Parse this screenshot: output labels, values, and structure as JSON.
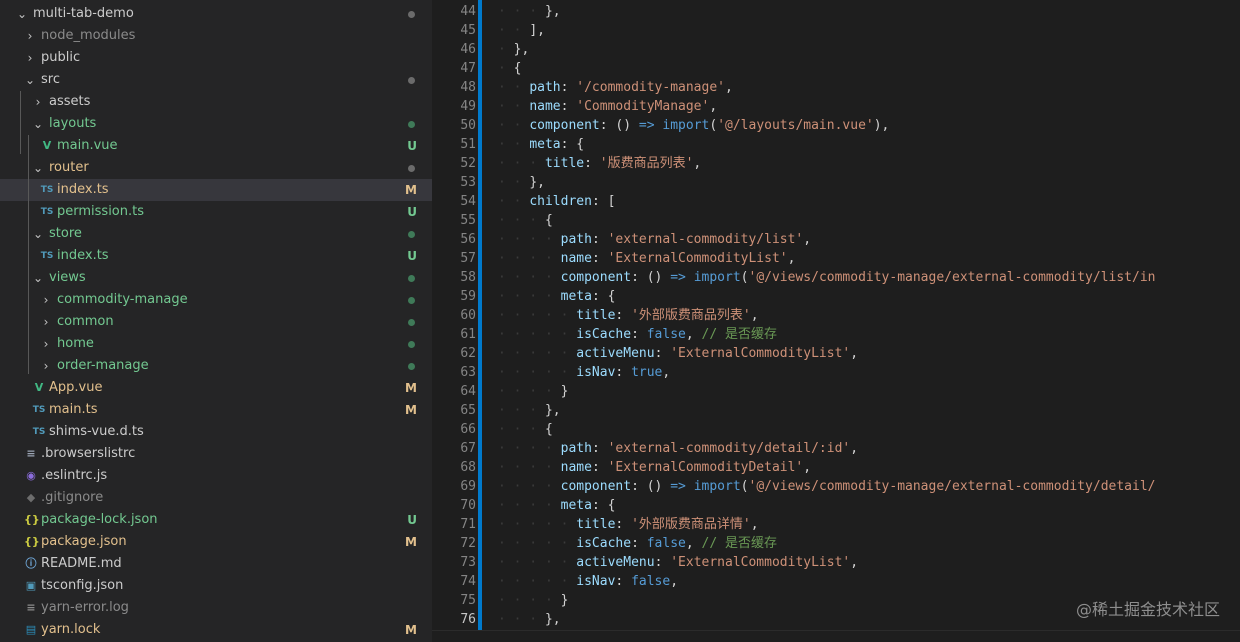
{
  "colors": {
    "folder_text": "#cccccc",
    "green_file": "#73c991",
    "modified_file": "#e2c08d",
    "untracked_badge": "#73c991",
    "modified_badge": "#e2c08d",
    "ts_icon": "#519aba",
    "vue_icon": "#41b883",
    "json_icon": "#cbcb41",
    "accent": "#007acc"
  },
  "explorer": {
    "rows": [
      {
        "label": "multi-tab-demo",
        "chevron": "⌄",
        "status": "dot-gray"
      },
      {
        "label": "node_modules",
        "chevron": "›",
        "dim": true
      },
      {
        "label": "public",
        "chevron": "›"
      },
      {
        "label": "src",
        "chevron": "⌄",
        "status": "dot-gray"
      },
      {
        "label": "assets",
        "chevron": "›"
      },
      {
        "label": "layouts",
        "chevron": "⌄",
        "status": "dot-green",
        "color": "green"
      },
      {
        "label": "main.vue",
        "icon": "vue-icon",
        "icon_glyph": "V",
        "badge": "U",
        "color": "green"
      },
      {
        "label": "router",
        "chevron": "⌄",
        "status": "dot-gray",
        "color": "yellow"
      },
      {
        "label": "index.ts",
        "icon": "ts-icon",
        "icon_glyph": "TS",
        "badge": "M",
        "color": "yellow",
        "selected": true
      },
      {
        "label": "permission.ts",
        "icon": "ts-icon",
        "icon_glyph": "TS",
        "badge": "U",
        "color": "green"
      },
      {
        "label": "store",
        "chevron": "⌄",
        "status": "dot-green",
        "color": "green"
      },
      {
        "label": "index.ts",
        "icon": "ts-icon",
        "icon_glyph": "TS",
        "badge": "U",
        "color": "green"
      },
      {
        "label": "views",
        "chevron": "⌄",
        "status": "dot-green",
        "color": "green"
      },
      {
        "label": "commodity-manage",
        "chevron": "›",
        "status": "dot-green",
        "color": "green"
      },
      {
        "label": "common",
        "chevron": "›",
        "status": "dot-green",
        "color": "green"
      },
      {
        "label": "home",
        "chevron": "›",
        "status": "dot-green",
        "color": "green"
      },
      {
        "label": "order-manage",
        "chevron": "›",
        "status": "dot-green",
        "color": "green"
      },
      {
        "label": "App.vue",
        "icon": "vue-icon",
        "icon_glyph": "V",
        "badge": "M",
        "color": "yellow"
      },
      {
        "label": "main.ts",
        "icon": "ts-icon",
        "icon_glyph": "TS",
        "badge": "M",
        "color": "yellow"
      },
      {
        "label": "shims-vue.d.ts",
        "icon": "ts-icon",
        "icon_glyph": "TS"
      },
      {
        "label": ".browserslistrc",
        "icon": "lines-icon",
        "icon_glyph": "≡"
      },
      {
        "label": ".eslintrc.js",
        "icon": "eslint-icon",
        "icon_glyph": "◉"
      },
      {
        "label": ".gitignore",
        "icon": "git-icon",
        "icon_glyph": "◆",
        "dim": true
      },
      {
        "label": "package-lock.json",
        "icon": "json-icon",
        "icon_glyph": "{}",
        "badge": "U",
        "color": "green"
      },
      {
        "label": "package.json",
        "icon": "json-icon",
        "icon_glyph": "{}",
        "badge": "M",
        "color": "yellow"
      },
      {
        "label": "README.md",
        "icon": "info-icon",
        "icon_glyph": "ⓘ"
      },
      {
        "label": "tsconfig.json",
        "icon": "tsconfig-icon",
        "icon_glyph": "▣"
      },
      {
        "label": "yarn-error.log",
        "icon": "log-icon",
        "icon_glyph": "≡",
        "dim": true
      },
      {
        "label": "yarn.lock",
        "icon": "yarn-icon",
        "icon_glyph": "▤",
        "badge": "M",
        "color": "yellow"
      }
    ]
  },
  "editor": {
    "active_line": "76",
    "lines": [
      {
        "n": "44",
        "indent": 3,
        "tokens": [
          [
            "p",
            "},"
          ]
        ]
      },
      {
        "n": "45",
        "indent": 2,
        "tokens": [
          [
            "p",
            "],"
          ]
        ]
      },
      {
        "n": "46",
        "indent": 1,
        "tokens": [
          [
            "p",
            "},"
          ]
        ]
      },
      {
        "n": "47",
        "indent": 1,
        "tokens": [
          [
            "p",
            "{"
          ]
        ]
      },
      {
        "n": "48",
        "indent": 2,
        "tokens": [
          [
            "k",
            "path"
          ],
          [
            "p",
            ": "
          ],
          [
            "s",
            "'/commodity-manage'"
          ],
          [
            "p",
            ","
          ]
        ]
      },
      {
        "n": "49",
        "indent": 2,
        "tokens": [
          [
            "k",
            "name"
          ],
          [
            "p",
            ": "
          ],
          [
            "s",
            "'CommodityManage'"
          ],
          [
            "p",
            ","
          ]
        ]
      },
      {
        "n": "50",
        "indent": 2,
        "tokens": [
          [
            "k",
            "component"
          ],
          [
            "p",
            ": () "
          ],
          [
            "kw",
            "=>"
          ],
          [
            "p",
            " "
          ],
          [
            "kw",
            "import"
          ],
          [
            "p",
            "("
          ],
          [
            "s",
            "'@/layouts/main.vue'"
          ],
          [
            "p",
            "),"
          ]
        ]
      },
      {
        "n": "51",
        "indent": 2,
        "tokens": [
          [
            "k",
            "meta"
          ],
          [
            "p",
            ": {"
          ]
        ]
      },
      {
        "n": "52",
        "indent": 3,
        "tokens": [
          [
            "k",
            "title"
          ],
          [
            "p",
            ": "
          ],
          [
            "s",
            "'版费商品列表'"
          ],
          [
            "p",
            ","
          ]
        ]
      },
      {
        "n": "53",
        "indent": 2,
        "tokens": [
          [
            "p",
            "},"
          ]
        ]
      },
      {
        "n": "54",
        "indent": 2,
        "tokens": [
          [
            "k",
            "children"
          ],
          [
            "p",
            ": ["
          ]
        ]
      },
      {
        "n": "55",
        "indent": 3,
        "tokens": [
          [
            "p",
            "{"
          ]
        ]
      },
      {
        "n": "56",
        "indent": 4,
        "tokens": [
          [
            "k",
            "path"
          ],
          [
            "p",
            ": "
          ],
          [
            "s",
            "'external-commodity/list'"
          ],
          [
            "p",
            ","
          ]
        ]
      },
      {
        "n": "57",
        "indent": 4,
        "tokens": [
          [
            "k",
            "name"
          ],
          [
            "p",
            ": "
          ],
          [
            "s",
            "'ExternalCommodityList'"
          ],
          [
            "p",
            ","
          ]
        ]
      },
      {
        "n": "58",
        "indent": 4,
        "tokens": [
          [
            "k",
            "component"
          ],
          [
            "p",
            ": () "
          ],
          [
            "kw",
            "=>"
          ],
          [
            "p",
            " "
          ],
          [
            "kw",
            "import"
          ],
          [
            "p",
            "("
          ],
          [
            "s",
            "'@/views/commodity-manage/external-commodity/list/ind"
          ]
        ]
      },
      {
        "n": "59",
        "indent": 4,
        "tokens": [
          [
            "k",
            "meta"
          ],
          [
            "p",
            ": {"
          ]
        ]
      },
      {
        "n": "60",
        "indent": 5,
        "tokens": [
          [
            "k",
            "title"
          ],
          [
            "p",
            ": "
          ],
          [
            "s",
            "'外部版费商品列表'"
          ],
          [
            "p",
            ","
          ]
        ]
      },
      {
        "n": "61",
        "indent": 5,
        "tokens": [
          [
            "k",
            "isCache"
          ],
          [
            "p",
            ": "
          ],
          [
            "kw",
            "false"
          ],
          [
            "p",
            ", "
          ],
          [
            "c",
            "// 是否缓存"
          ]
        ]
      },
      {
        "n": "62",
        "indent": 5,
        "tokens": [
          [
            "k",
            "activeMenu"
          ],
          [
            "p",
            ": "
          ],
          [
            "s",
            "'ExternalCommodityList'"
          ],
          [
            "p",
            ","
          ]
        ]
      },
      {
        "n": "63",
        "indent": 5,
        "tokens": [
          [
            "k",
            "isNav"
          ],
          [
            "p",
            ": "
          ],
          [
            "kw",
            "true"
          ],
          [
            "p",
            ","
          ]
        ]
      },
      {
        "n": "64",
        "indent": 4,
        "tokens": [
          [
            "p",
            "}"
          ]
        ]
      },
      {
        "n": "65",
        "indent": 3,
        "tokens": [
          [
            "p",
            "},"
          ]
        ]
      },
      {
        "n": "66",
        "indent": 3,
        "tokens": [
          [
            "p",
            "{"
          ]
        ]
      },
      {
        "n": "67",
        "indent": 4,
        "tokens": [
          [
            "k",
            "path"
          ],
          [
            "p",
            ": "
          ],
          [
            "s",
            "'external-commodity/detail/:id'"
          ],
          [
            "p",
            ","
          ]
        ]
      },
      {
        "n": "68",
        "indent": 4,
        "tokens": [
          [
            "k",
            "name"
          ],
          [
            "p",
            ": "
          ],
          [
            "s",
            "'ExternalCommodityDetail'"
          ],
          [
            "p",
            ","
          ]
        ]
      },
      {
        "n": "69",
        "indent": 4,
        "tokens": [
          [
            "k",
            "component"
          ],
          [
            "p",
            ": () "
          ],
          [
            "kw",
            "=>"
          ],
          [
            "p",
            " "
          ],
          [
            "kw",
            "import"
          ],
          [
            "p",
            "("
          ],
          [
            "s",
            "'@/views/commodity-manage/external-commodity/detail/i"
          ]
        ]
      },
      {
        "n": "70",
        "indent": 4,
        "tokens": [
          [
            "k",
            "meta"
          ],
          [
            "p",
            ": {"
          ]
        ]
      },
      {
        "n": "71",
        "indent": 5,
        "tokens": [
          [
            "k",
            "title"
          ],
          [
            "p",
            ": "
          ],
          [
            "s",
            "'外部版费商品详情'"
          ],
          [
            "p",
            ","
          ]
        ]
      },
      {
        "n": "72",
        "indent": 5,
        "tokens": [
          [
            "k",
            "isCache"
          ],
          [
            "p",
            ": "
          ],
          [
            "kw",
            "false"
          ],
          [
            "p",
            ", "
          ],
          [
            "c",
            "// 是否缓存"
          ]
        ]
      },
      {
        "n": "73",
        "indent": 5,
        "tokens": [
          [
            "k",
            "activeMenu"
          ],
          [
            "p",
            ": "
          ],
          [
            "s",
            "'ExternalCommodityList'"
          ],
          [
            "p",
            ","
          ]
        ]
      },
      {
        "n": "74",
        "indent": 5,
        "tokens": [
          [
            "k",
            "isNav"
          ],
          [
            "p",
            ": "
          ],
          [
            "kw",
            "false"
          ],
          [
            "p",
            ","
          ]
        ]
      },
      {
        "n": "75",
        "indent": 4,
        "tokens": [
          [
            "p",
            "}"
          ]
        ]
      },
      {
        "n": "76",
        "indent": 3,
        "tokens": [
          [
            "p",
            "},"
          ]
        ]
      }
    ]
  },
  "watermark": "@稀土掘金技术社区"
}
